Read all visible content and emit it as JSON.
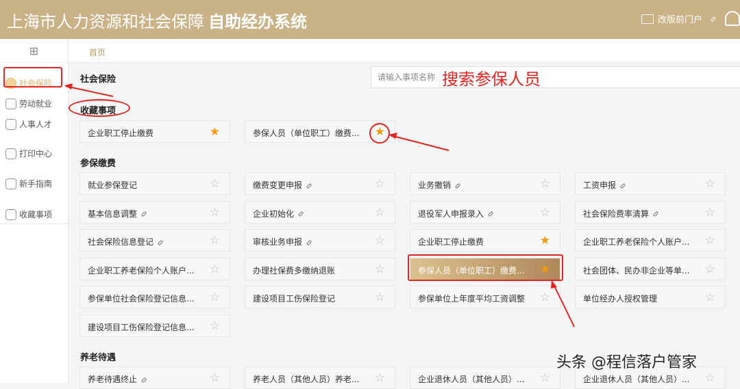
{
  "header": {
    "title_light": "上海市人力资源和社会保障",
    "title_bold": "自助经办系统",
    "portal_link": "改版前门户"
  },
  "sidebar": {
    "items": [
      {
        "label": "社会保险",
        "active": true
      },
      {
        "label": "劳动就业"
      },
      {
        "label": "人事人才"
      },
      {
        "label": "打印中心"
      },
      {
        "label": "新手指南"
      },
      {
        "label": "收藏事项"
      }
    ]
  },
  "breadcrumb": "首页",
  "page_title": "社会保险",
  "search": {
    "placeholder": "请输入事项名称"
  },
  "annotation": {
    "search_hint": "搜索参保人员"
  },
  "favorites": {
    "title": "收藏事项",
    "items": [
      {
        "label": "企业职工停止缴费",
        "starred": true
      },
      {
        "label": "参保人员（单位职工）缴费...",
        "starred": true
      }
    ]
  },
  "sections": [
    {
      "title": "参保缴费",
      "items": [
        {
          "label": "就业参保登记"
        },
        {
          "label": "缴费变更申报",
          "link": true
        },
        {
          "label": "业务撤销",
          "link": true
        },
        {
          "label": "工资申报",
          "link": true
        },
        {
          "label": "基本信息调整",
          "link": true
        },
        {
          "label": "企业初始化",
          "link": true
        },
        {
          "label": "退役军人申报录入",
          "link": true
        },
        {
          "label": "社会保险费率清算",
          "link": true
        },
        {
          "label": "社会保险信息登记",
          "link": true
        },
        {
          "label": "审核业务申报",
          "link": true
        },
        {
          "label": "企业职工停止缴费",
          "starred": true
        },
        {
          "label": "企业职工养老保险个人账户..."
        },
        {
          "label": "企业职工养老保险个人账户..."
        },
        {
          "label": "办理社保费多缴纳退账"
        },
        {
          "label": "参保人员（单位职工）缴费...",
          "starred": true,
          "highlight": true
        },
        {
          "label": "社会团体、民办非企业等单..."
        },
        {
          "label": "参保单位社会保险登记信息..."
        },
        {
          "label": "建设项目工伤保险登记"
        },
        {
          "label": "参保单位上年度平均工资调整"
        },
        {
          "label": "单位经办人授权管理"
        },
        {
          "label": "建设项目工伤保险登记信息..."
        }
      ]
    },
    {
      "title": "养老待遇",
      "items": [
        {
          "label": "养老待遇终止",
          "link": true
        },
        {
          "label": "养老人员（其他人员）养老..."
        },
        {
          "label": "企业退休人员（其他人员）..."
        },
        {
          "label": "企业退休人员（其他人员）..."
        }
      ]
    }
  ],
  "watermark": "头条 @程信落户管家"
}
